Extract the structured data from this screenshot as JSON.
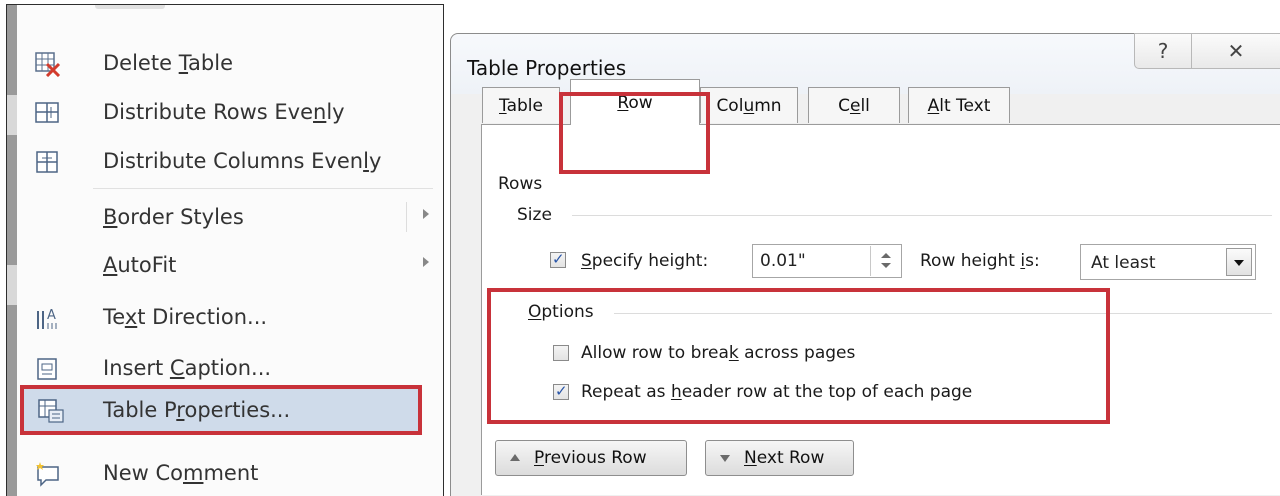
{
  "context_menu": {
    "items": [
      {
        "label": "Delete Table",
        "mnemonic": "T",
        "icon": "delete-table-icon"
      },
      {
        "label": "Distribute Rows Evenly",
        "mnemonic": "n",
        "icon": "distribute-rows-icon"
      },
      {
        "label": "Distribute Columns Evenly",
        "mnemonic": "y",
        "icon": "distribute-columns-icon"
      },
      {
        "label": "Border Styles",
        "mnemonic": "B"
      },
      {
        "label": "AutoFit",
        "mnemonic": "A"
      },
      {
        "label": "Text Direction...",
        "mnemonic": "x",
        "icon": "text-direction-icon"
      },
      {
        "label": "Insert Caption...",
        "mnemonic": "C",
        "icon": "insert-caption-icon"
      },
      {
        "label": "Table Properties...",
        "mnemonic": "r",
        "icon": "table-properties-icon"
      },
      {
        "label": "New Comment",
        "mnemonic": "m",
        "icon": "new-comment-icon"
      }
    ]
  },
  "dialog": {
    "title": "Table Properties",
    "tabs": [
      {
        "label": "Table",
        "mnemonic": "T"
      },
      {
        "label": "Row",
        "mnemonic": "R"
      },
      {
        "label": "Column",
        "mnemonic": "u"
      },
      {
        "label": "Cell",
        "mnemonic": "e"
      },
      {
        "label": "Alt Text",
        "mnemonic": "A"
      }
    ],
    "active_tab": "Row",
    "rows_group": "Rows",
    "size_group": "Size",
    "specify_height": {
      "label": "Specify height:",
      "checked": true
    },
    "height_value": "0.01\"",
    "row_height_is_label": "Row height is:",
    "row_height_is_value": "At least",
    "options_group": "Options",
    "allow_break": {
      "label": "Allow row to break across pages",
      "checked": false
    },
    "repeat_header": {
      "label": "Repeat as header row at the top of each page",
      "checked": true
    },
    "previous_row": "Previous Row",
    "next_row": "Next Row"
  },
  "colors": {
    "highlight_border": "#c8323a",
    "menu_selection": "#cfdbea",
    "checkbox_check": "#2a56a8"
  }
}
